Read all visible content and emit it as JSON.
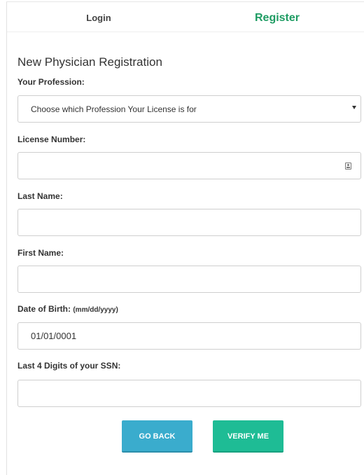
{
  "tabs": {
    "login": "Login",
    "register": "Register"
  },
  "form": {
    "heading": "New Physician Registration",
    "profession": {
      "label": "Your Profession:",
      "selected": "Choose which Profession Your License is for"
    },
    "license": {
      "label": "License Number:",
      "value": ""
    },
    "last_name": {
      "label": "Last Name:",
      "value": ""
    },
    "first_name": {
      "label": "First Name:",
      "value": ""
    },
    "dob": {
      "label": "Date of Birth:",
      "hint": "(mm/dd/yyyy)",
      "value": "01/01/0001"
    },
    "ssn": {
      "label": "Last 4 Digits of your SSN:",
      "value": ""
    }
  },
  "buttons": {
    "back": "GO BACK",
    "verify": "VERIFY ME"
  },
  "colors": {
    "register_tab": "#1e9c63",
    "back_button": "#3aaccd",
    "verify_button": "#1ebc95"
  },
  "icons": {
    "profession_select": "chevron-down-icon",
    "license_field": "contact-card-icon"
  }
}
